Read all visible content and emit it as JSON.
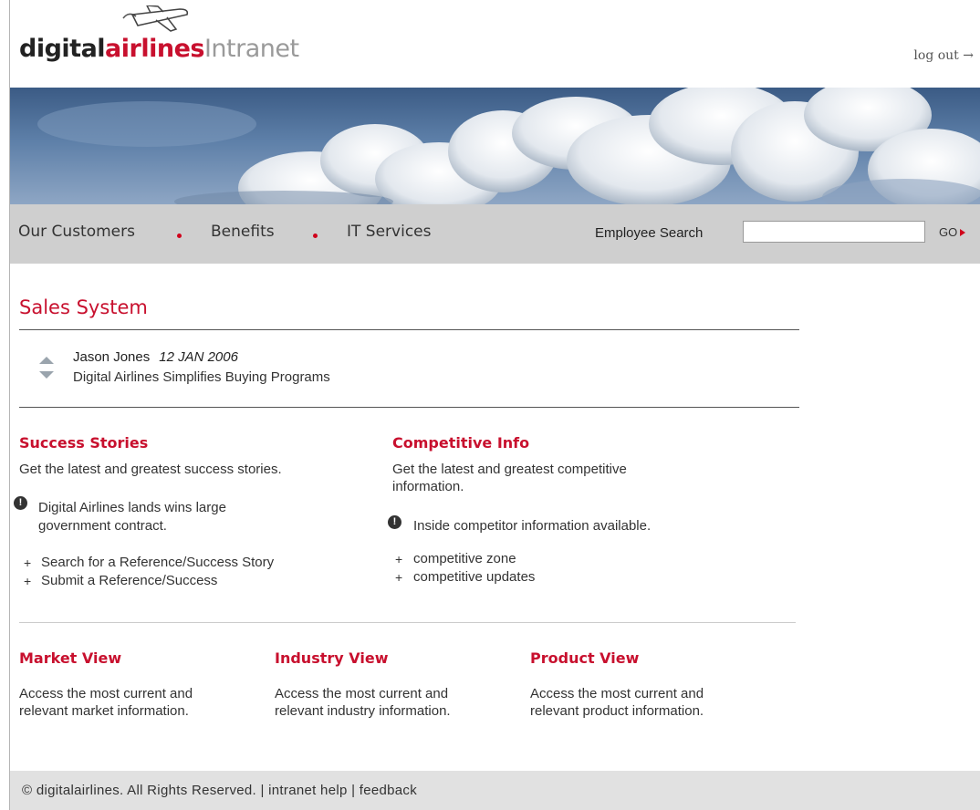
{
  "header": {
    "logo_part1": "digital",
    "logo_part2": "airlines",
    "logo_part3": "Intranet",
    "logout": "log out →"
  },
  "nav": {
    "items": [
      "Our Customers",
      "Benefits",
      "IT Services"
    ],
    "search_label": "Employee Search",
    "search_value": "",
    "go_label": "GO"
  },
  "sales": {
    "title": "Sales System",
    "news_author": "Jason Jones",
    "news_date": "12 JAN 2006",
    "news_headline": "Digital Airlines Simplifies Buying Programs"
  },
  "success": {
    "title": "Success Stories",
    "desc": "Get the latest and greatest success stories.",
    "alert_line1": "Digital Airlines lands wins large",
    "alert_line2": "government contract.",
    "links": [
      "Search for a Reference/Success Story",
      "Submit a Reference/Success"
    ]
  },
  "competitive": {
    "title": "Competitive Info",
    "desc_line1": "Get the latest and greatest competitive",
    "desc_line2": "information.",
    "alert": "Inside competitor information available.",
    "links": [
      "competitive zone",
      "competitive updates"
    ]
  },
  "views": [
    {
      "title": "Market View",
      "line1": "Access the most current and",
      "line2": "relevant market information."
    },
    {
      "title": "Industry View",
      "line1": "Access the most current and",
      "line2": "relevant industry information."
    },
    {
      "title": "Product View",
      "line1": "Access the most current and",
      "line2": "relevant product information."
    }
  ],
  "footer": {
    "text": "© digitalairlines.  All Rights Reserved. | intranet help | feedback"
  },
  "colors": {
    "accent": "#c8102e",
    "nav_bg": "#cfcfcf",
    "footer_bg": "#e1e1e1"
  }
}
